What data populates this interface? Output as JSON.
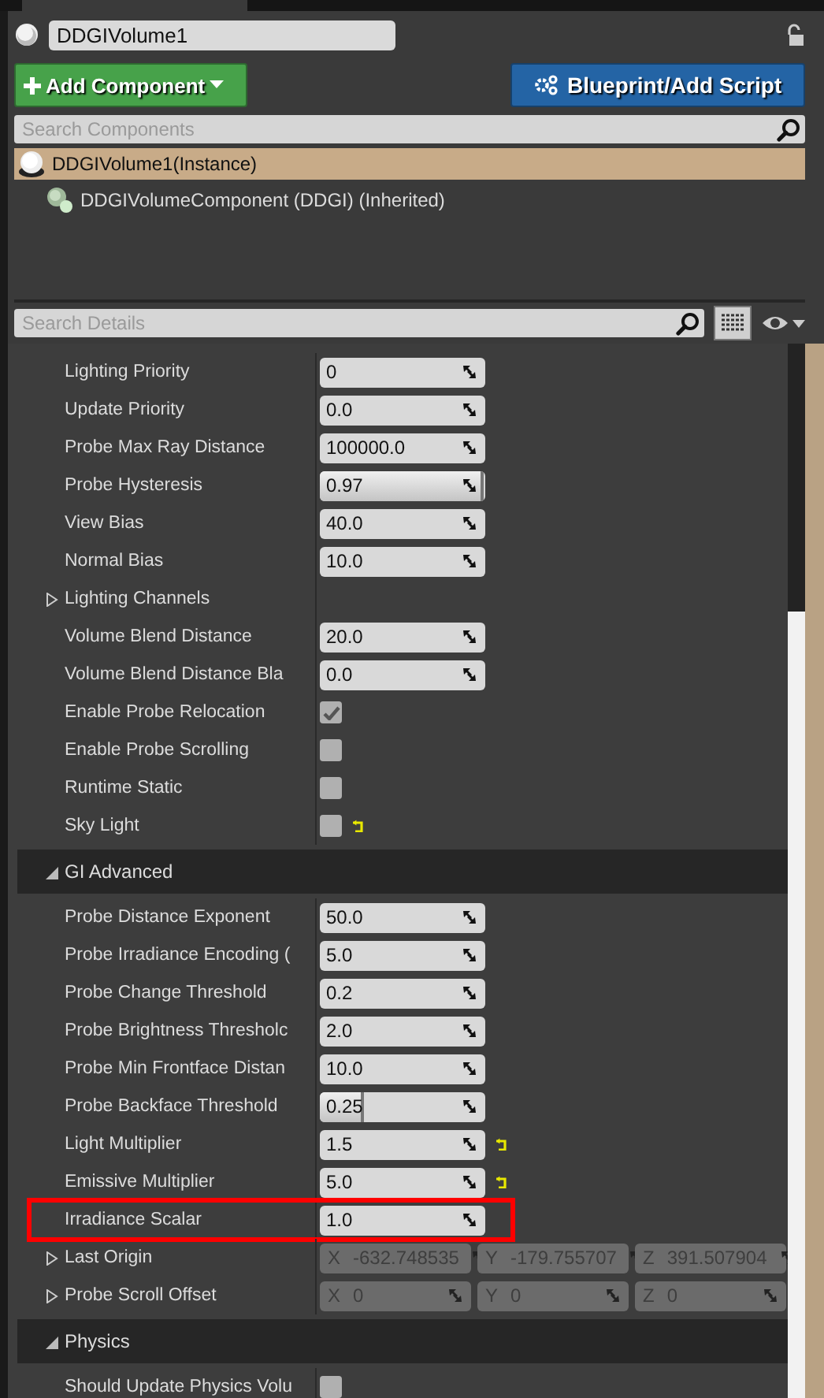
{
  "actor": {
    "name": "DDGIVolume1"
  },
  "buttons": [
    {
      "kind": "add",
      "label": "Add Component"
    },
    {
      "kind": "script",
      "label": "Blueprint/Add Script"
    }
  ],
  "component_search": {
    "placeholder": "Search Components"
  },
  "components": [
    {
      "label": "DDGIVolume1(Instance)",
      "selected": true,
      "children": [
        {
          "label": "DDGIVolumeComponent (DDGI) (Inherited)",
          "selected": false
        }
      ]
    }
  ],
  "details_search": {
    "placeholder": "Search Details"
  },
  "rows": [
    {
      "kind": "number",
      "label": "Lighting Priority",
      "value": "0"
    },
    {
      "kind": "number",
      "label": "Update Priority",
      "value": "0.0"
    },
    {
      "kind": "number",
      "label": "Probe Max Ray Distance",
      "value": "100000.0"
    },
    {
      "kind": "number",
      "label": "Probe Hysteresis",
      "value": "0.97",
      "level": 0.97
    },
    {
      "kind": "number",
      "label": "View Bias",
      "value": "40.0"
    },
    {
      "kind": "number",
      "label": "Normal Bias",
      "value": "10.0"
    },
    {
      "kind": "group",
      "label": "Lighting Channels",
      "expanded": false
    },
    {
      "kind": "number",
      "label": "Volume Blend Distance",
      "value": "20.0"
    },
    {
      "kind": "number",
      "label": "Volume Blend Distance Bla",
      "value": "0.0"
    },
    {
      "kind": "check",
      "label": "Enable Probe Relocation",
      "checked": true
    },
    {
      "kind": "check",
      "label": "Enable Probe Scrolling",
      "checked": false
    },
    {
      "kind": "check",
      "label": "Runtime Static",
      "checked": false
    },
    {
      "kind": "check",
      "label": "Sky Light",
      "checked": false,
      "reset": true
    },
    {
      "kind": "category",
      "label": "GI Advanced",
      "expanded": true
    },
    {
      "kind": "number",
      "label": "Probe Distance Exponent",
      "value": "50.0"
    },
    {
      "kind": "number",
      "label": "Probe Irradiance Encoding (",
      "value": "5.0"
    },
    {
      "kind": "number",
      "label": "Probe Change Threshold",
      "value": "0.2"
    },
    {
      "kind": "number",
      "label": "Probe Brightness Thresholc",
      "value": "2.0"
    },
    {
      "kind": "number",
      "label": "Probe Min Frontface Distan",
      "value": "10.0"
    },
    {
      "kind": "number",
      "label": "Probe Backface Threshold",
      "value": "0.25",
      "level": 0.25
    },
    {
      "kind": "number",
      "label": "Light Multiplier",
      "value": "1.5",
      "reset": true
    },
    {
      "kind": "number",
      "label": "Emissive Multiplier",
      "value": "5.0",
      "reset": true
    },
    {
      "kind": "number",
      "label": "Irradiance Scalar",
      "value": "1.0",
      "highlight": true
    },
    {
      "kind": "vector",
      "label": "Last Origin",
      "expanded": false,
      "disabled": true,
      "components": [
        {
          "axis": "X",
          "value": "-632.748535"
        },
        {
          "axis": "Y",
          "value": "-179.755707"
        },
        {
          "axis": "Z",
          "value": "391.507904"
        }
      ]
    },
    {
      "kind": "vector",
      "label": "Probe Scroll Offset",
      "expanded": false,
      "disabled": true,
      "components": [
        {
          "axis": "X",
          "value": "0"
        },
        {
          "axis": "Y",
          "value": "0"
        },
        {
          "axis": "Z",
          "value": "0"
        }
      ]
    },
    {
      "kind": "category",
      "label": "Physics",
      "expanded": true
    },
    {
      "kind": "check",
      "label": "Should Update Physics Volu",
      "checked": false
    }
  ]
}
